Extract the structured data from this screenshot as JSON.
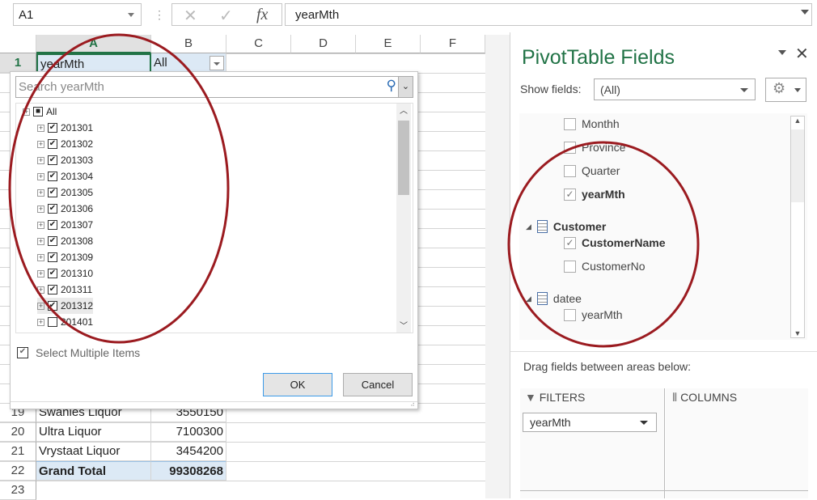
{
  "formula_bar": {
    "name_box": "A1",
    "cancel": "✕",
    "enter": "✓",
    "fx": "fx",
    "value": "yearMth"
  },
  "columns": [
    "A",
    "B",
    "C",
    "D",
    "E",
    "F"
  ],
  "sheet": {
    "row1": {
      "num": "1",
      "a": "yearMth",
      "b": "All"
    },
    "rows": [
      {
        "num": "19",
        "a": "Swanies Liquor",
        "b": "3550150"
      },
      {
        "num": "20",
        "a": "Ultra Liquor",
        "b": "7100300"
      },
      {
        "num": "21",
        "a": "Vrystaat Liquor",
        "b": "3454200"
      }
    ],
    "total": {
      "num": "22",
      "a": "Grand Total",
      "b": "99308268"
    },
    "row23": "23"
  },
  "filter_popup": {
    "search_placeholder": "Search yearMth",
    "items": [
      {
        "label": "All",
        "state": "partial"
      },
      {
        "label": "201301",
        "checked": true
      },
      {
        "label": "201302",
        "checked": true
      },
      {
        "label": "201303",
        "checked": true
      },
      {
        "label": "201304",
        "checked": true
      },
      {
        "label": "201305",
        "checked": true
      },
      {
        "label": "201306",
        "checked": true
      },
      {
        "label": "201307",
        "checked": true
      },
      {
        "label": "201308",
        "checked": true
      },
      {
        "label": "201309",
        "checked": true
      },
      {
        "label": "201310",
        "checked": true
      },
      {
        "label": "201311",
        "checked": true
      },
      {
        "label": "201312",
        "checked": true
      },
      {
        "label": "201401",
        "checked": false
      }
    ],
    "select_multiple": "Select Multiple Items",
    "ok": "OK",
    "cancel": "Cancel"
  },
  "pivot_pane": {
    "title": "PivotTable Fields",
    "show_fields_label": "Show fields:",
    "show_fields_value": "(All)",
    "fields": [
      {
        "label": "Monthh",
        "checked": false
      },
      {
        "label": "Province",
        "checked": false
      },
      {
        "label": "Quarter",
        "checked": false
      },
      {
        "label": "yearMth",
        "checked": true
      }
    ],
    "groups": [
      {
        "name": "Customer",
        "fields": [
          {
            "label": "CustomerName",
            "checked": true
          },
          {
            "label": "CustomerNo",
            "checked": false
          }
        ]
      },
      {
        "name": "datee",
        "fields": [
          {
            "label": "yearMth",
            "checked": false
          }
        ]
      }
    ],
    "drag_label": "Drag fields between areas below:",
    "filters_label": "FILTERS",
    "columns_label": "COLUMNS",
    "filter_field": "yearMth"
  },
  "colors": {
    "accent": "#217346",
    "annotation": "#9b1b20",
    "selection": "#dce9f5"
  }
}
